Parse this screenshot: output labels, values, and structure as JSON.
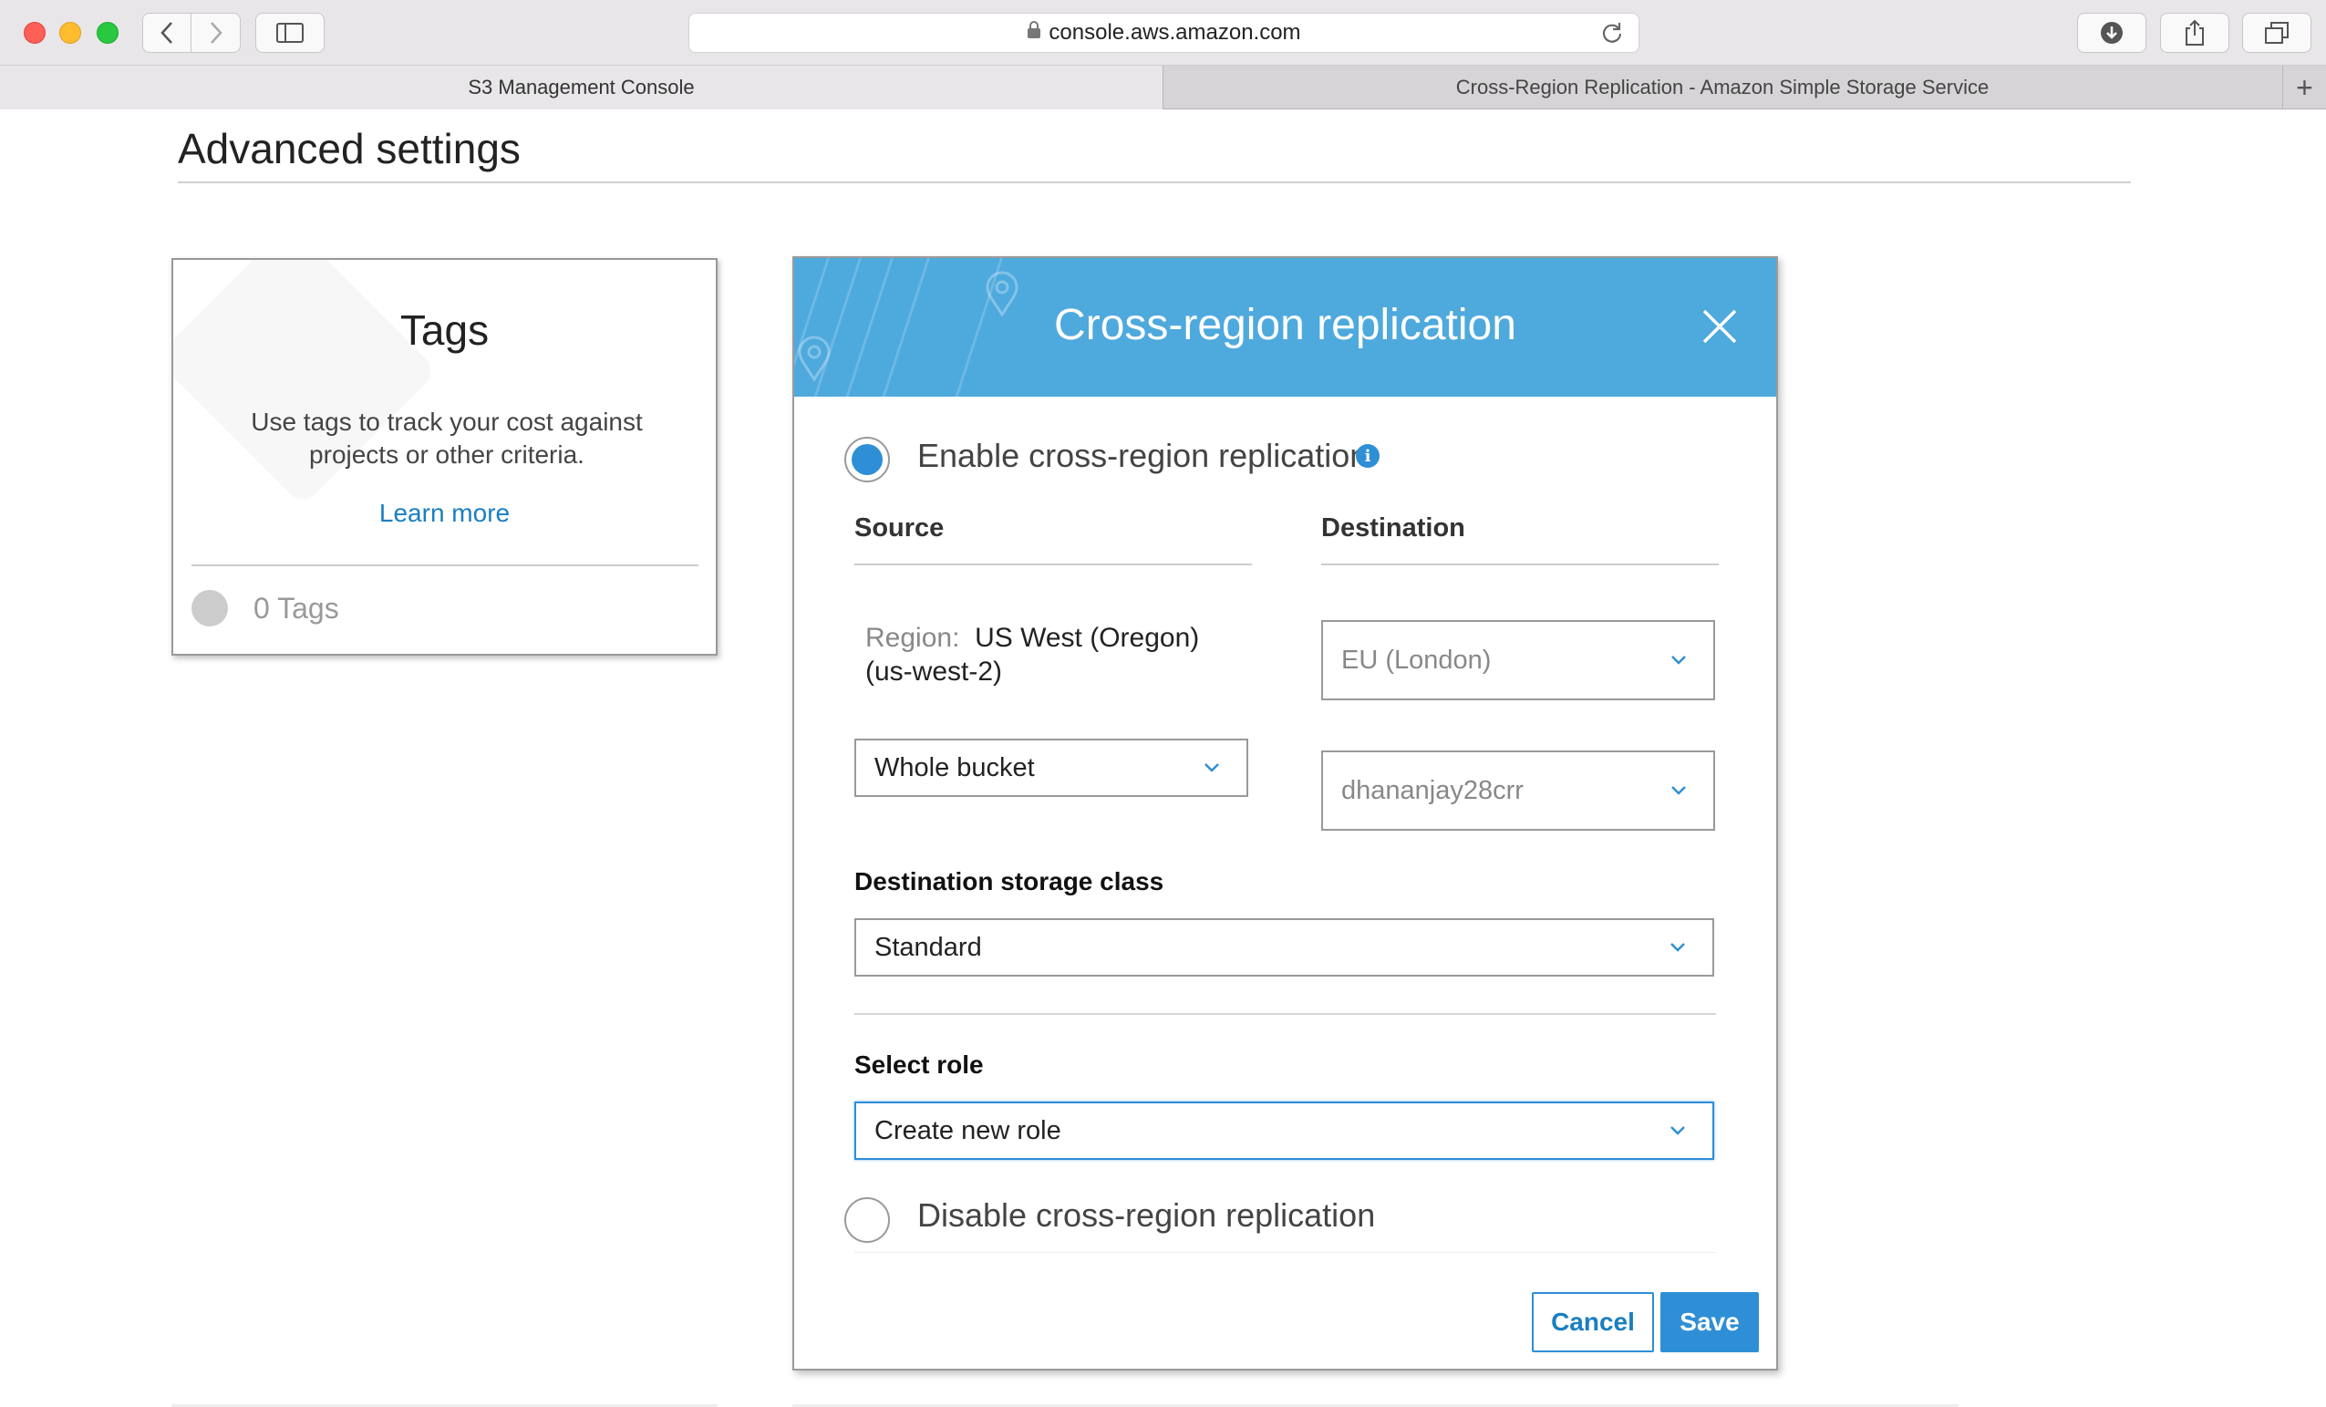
{
  "browser": {
    "url": "console.aws.amazon.com",
    "tabs": [
      {
        "label": "S3 Management Console"
      },
      {
        "label": "Cross-Region Replication - Amazon Simple Storage Service"
      }
    ],
    "new_tab": "+"
  },
  "page": {
    "heading": "Advanced settings"
  },
  "tags_card": {
    "title": "Tags",
    "description": "Use tags to track your cost against projects or other criteria.",
    "learn_more": "Learn more",
    "count": "0 Tags"
  },
  "modal": {
    "title": "Cross-region replication",
    "enable_label": "Enable cross-region replication",
    "info": "i",
    "source_heading": "Source",
    "destination_heading": "Destination",
    "region_label": "Region:",
    "region_value": "US West (Oregon) (us-west-2)",
    "scope_select": "Whole bucket",
    "dest_region_select": "EU (London)",
    "dest_bucket_select": "dhananjay28crr",
    "storage_class_label": "Destination storage class",
    "storage_class_select": "Standard",
    "role_label": "Select role",
    "role_select": "Create new role",
    "disable_label": "Disable cross-region replication",
    "cancel": "Cancel",
    "save": "Save"
  },
  "colors": {
    "accent": "#2e8fd6",
    "header": "#4ea9dd",
    "link": "#1a7ec2"
  }
}
